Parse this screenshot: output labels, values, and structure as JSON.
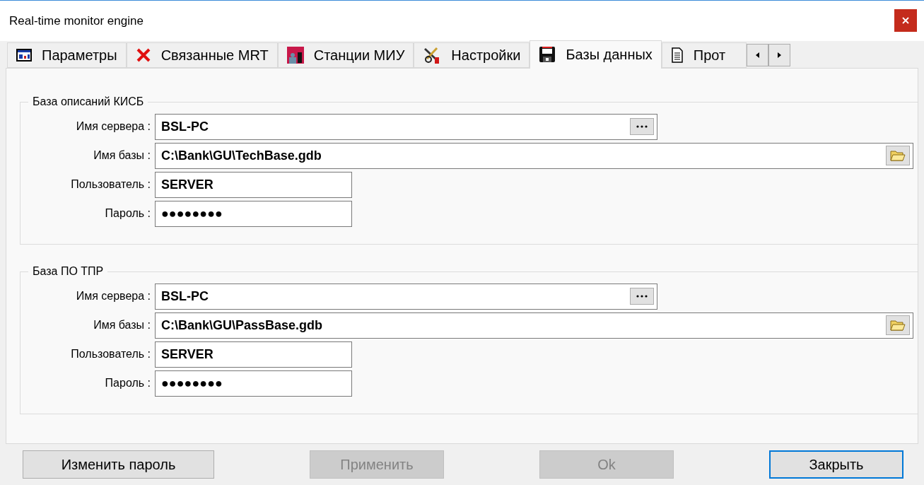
{
  "window": {
    "title": "Real-time monitor engine"
  },
  "tabs": [
    {
      "label": "Параметры",
      "selected": false
    },
    {
      "label": "Связанные MRT",
      "selected": false
    },
    {
      "label": "Станции МИУ",
      "selected": false
    },
    {
      "label": "Настройки",
      "selected": false
    },
    {
      "label": "Базы данных",
      "selected": true
    },
    {
      "label": "Прот",
      "selected": false
    }
  ],
  "groups": [
    {
      "title": "База описаний КИСБ",
      "fields": [
        {
          "label": "Имя сервера :",
          "kind": "server",
          "value": "BSL-PC"
        },
        {
          "label": "Имя базы :",
          "kind": "path",
          "value": "C:\\Bank\\GU\\TechBase.gdb"
        },
        {
          "label": "Пользователь :",
          "kind": "text",
          "value": "SERVER"
        },
        {
          "label": "Пароль :",
          "kind": "password",
          "value": "●●●●●●●●"
        }
      ]
    },
    {
      "title": "База ПО ТПР",
      "fields": [
        {
          "label": "Имя сервера :",
          "kind": "server",
          "value": "BSL-PC"
        },
        {
          "label": "Имя базы :",
          "kind": "path",
          "value": "C:\\Bank\\GU\\PassBase.gdb"
        },
        {
          "label": "Пользователь :",
          "kind": "text",
          "value": "SERVER"
        },
        {
          "label": "Пароль :",
          "kind": "password",
          "value": "●●●●●●●●"
        }
      ]
    }
  ],
  "buttons": [
    {
      "label": "Изменить пароль",
      "disabled": false,
      "focused": false
    },
    {
      "label": "Применить",
      "disabled": true,
      "focused": false
    },
    {
      "label": "Ok",
      "disabled": true,
      "focused": false
    },
    {
      "label": "Закрыть",
      "disabled": false,
      "focused": true
    }
  ]
}
